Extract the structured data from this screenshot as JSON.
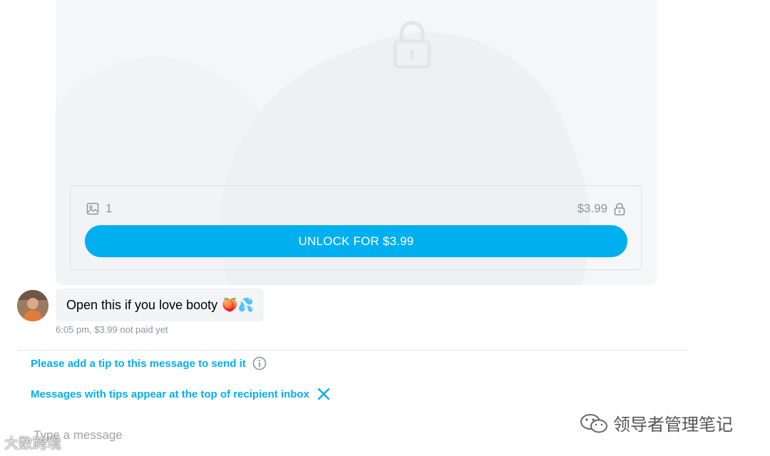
{
  "post": {
    "media_count": "1",
    "price": "$3.99",
    "unlock_label": "UNLOCK FOR $3.99"
  },
  "message": {
    "text": "Open this if you love booty",
    "emojis": "🍑💦",
    "time": "6:05 pm,",
    "price_status": "$3.99 not paid yet"
  },
  "notices": {
    "tip_required": "Please add a tip to this message to send it",
    "tip_info": "Messages with tips appear at the top of recipient inbox"
  },
  "composer": {
    "placeholder": "Type a message"
  },
  "watermarks": {
    "right": "领导者管理笔记",
    "left": "大数跨境"
  },
  "colors": {
    "accent": "#00aff0",
    "muted": "#8a96a3",
    "bubble": "#f2f4f6"
  },
  "icons": {
    "media": "image-icon",
    "lock": "lock-icon",
    "info": "info-icon",
    "close": "close-icon"
  }
}
